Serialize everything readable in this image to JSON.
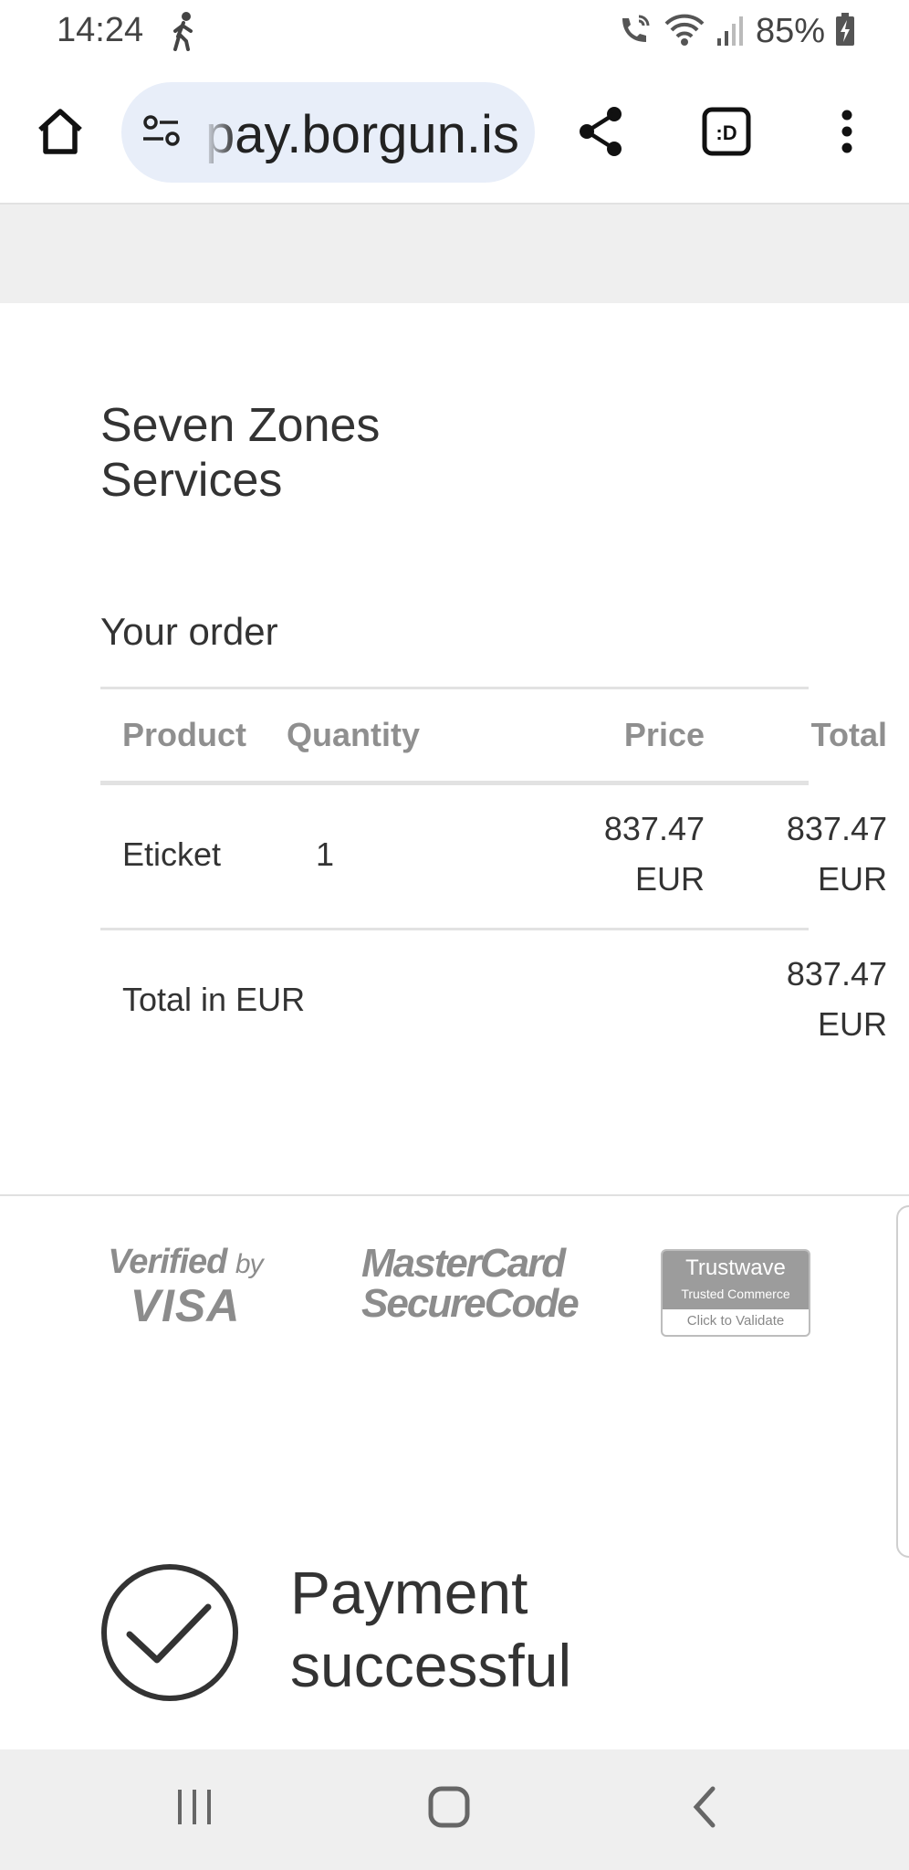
{
  "status_bar": {
    "time": "14:24",
    "battery": "85%"
  },
  "browser": {
    "url": "pay.borgun.is"
  },
  "merchant": {
    "name": "Seven Zones Services"
  },
  "order": {
    "heading": "Your order",
    "columns": [
      "Product",
      "Quantity",
      "Price",
      "Total"
    ],
    "items": [
      {
        "product": "Eticket",
        "quantity": "1",
        "price": "837.47",
        "price_currency": "EUR",
        "total": "837.47",
        "total_currency": "EUR"
      }
    ],
    "total_label": "Total in EUR",
    "total_value": "837.47",
    "total_currency": "EUR"
  },
  "security_logos": {
    "visa_top": "Verified",
    "visa_by": "by",
    "visa_bottom": "VISA",
    "mastercard_line1": "MasterCard",
    "mastercard_line2": "SecureCode",
    "trustwave_name": "Trustwave",
    "trustwave_sub": "Trusted Commerce",
    "trustwave_action": "Click to Validate"
  },
  "payment": {
    "status": "Payment successful"
  },
  "colors": {
    "accent_pill": "#e8eef9",
    "text": "#333333",
    "muted": "#8f8f8f"
  }
}
